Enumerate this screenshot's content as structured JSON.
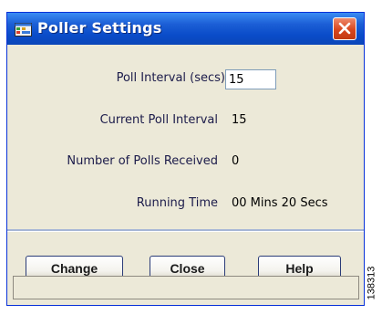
{
  "window": {
    "title": "Poller Settings",
    "icon": "app-window-icon",
    "close_icon": "close-icon"
  },
  "fields": {
    "poll_interval_label": "Poll Interval (secs)",
    "poll_interval_value": "15",
    "current_poll_label": "Current Poll Interval",
    "current_poll_value": "15",
    "polls_received_label": "Number of Polls Received",
    "polls_received_value": "0",
    "running_time_label": "Running Time",
    "running_time_value": "00 Mins 20 Secs"
  },
  "buttons": {
    "change": "Change",
    "close": "Close",
    "help": "Help"
  },
  "figure_id": "138313",
  "colors": {
    "title_bar": "#0a4cc9",
    "close_button": "#d9461d",
    "dialog_bg": "#ece9d8"
  }
}
